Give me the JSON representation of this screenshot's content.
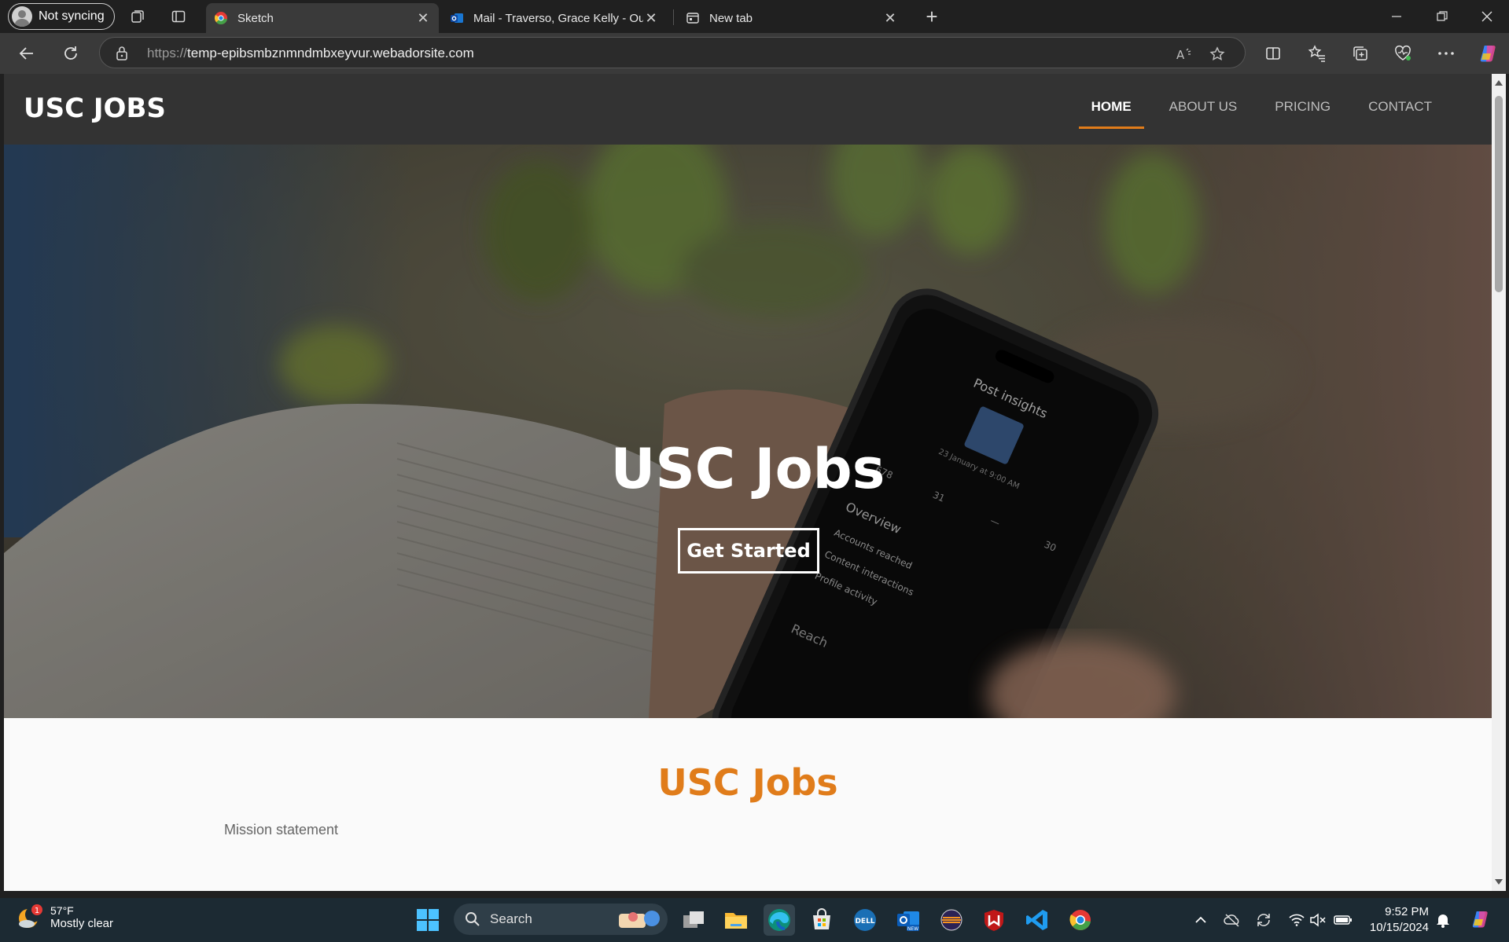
{
  "browser": {
    "profile_label": "Not syncing",
    "tabs": [
      {
        "title": "Sketch",
        "active": true
      },
      {
        "title": "Mail - Traverso, Grace Kelly - Outl",
        "active": false
      },
      {
        "title": "New tab",
        "active": false
      }
    ],
    "address": {
      "scheme": "https://",
      "host": "temp-epibsmbznmndmbxeyvur.webadorsite.com"
    }
  },
  "site": {
    "logo": "USC JOBS",
    "nav": [
      {
        "label": "HOME",
        "active": true
      },
      {
        "label": "ABOUT US",
        "active": false
      },
      {
        "label": "PRICING",
        "active": false
      },
      {
        "label": "CONTACT",
        "active": false
      }
    ],
    "hero": {
      "title": "USC Jobs",
      "button": "Get Started",
      "phone_screen": {
        "heading": "Post insights",
        "date": "23 January at 9:00 AM",
        "stats": [
          "678",
          "31",
          "—",
          "30"
        ],
        "overview": "Overview",
        "rows": [
          "Accounts reached",
          "Content interactions",
          "Profile activity"
        ],
        "reach": "Reach"
      }
    },
    "section": {
      "title": "USC Jobs",
      "text": "Mission statement"
    },
    "accent_color": "#e07c1a"
  },
  "taskbar": {
    "weather": {
      "temp": "57°F",
      "condition": "Mostly clear",
      "badge": "1"
    },
    "search_placeholder": "Search",
    "time": "9:52 PM",
    "date": "10/15/2024"
  }
}
